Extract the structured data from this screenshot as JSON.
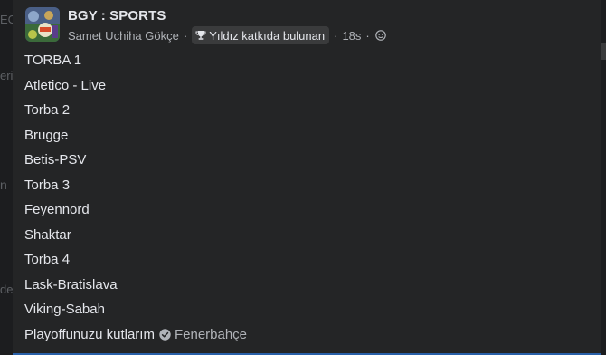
{
  "background": {
    "left_fragments": [
      "EC",
      "eri",
      "n",
      "de"
    ]
  },
  "post": {
    "group_name": "BGY : SPORTS",
    "author": "Samet Uchiha Gökçe",
    "separator": "·",
    "badge_label": "Yıldız katkıda bulunan",
    "time": "18s",
    "avatar_icon": "group-avatar-icon",
    "badge_icon": "trophy-icon",
    "audience_icon": "group-audience-icon",
    "lines": [
      "TORBA 1",
      "Atletico - Live",
      "Torba 2",
      "Brugge",
      "Betis-PSV",
      "Torba 3",
      "Feyennord",
      "Shaktar",
      "Torba 4",
      "Lask-Bratislava",
      "Viking-Sabah"
    ],
    "closing_text": "Playoffunuzu kutlarım",
    "check_icon": "check-circle-icon",
    "tagged_name": "Fenerbahçe"
  },
  "colors": {
    "post_bg": "#242526",
    "page_bg": "#18191a",
    "primary_text": "#e4e6eb",
    "secondary_text": "#b0b3b8",
    "badge_bg": "#3a3b3c",
    "accent": "#2d88ff"
  }
}
